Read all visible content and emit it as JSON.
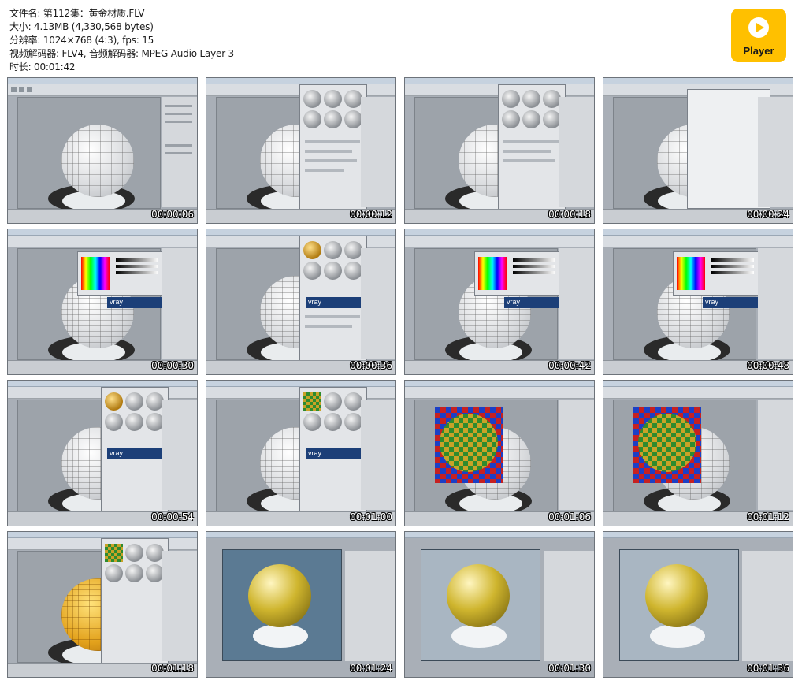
{
  "info": {
    "filename": "文件名: 第112集：黄金材质.FLV",
    "size": "大小: 4.13MB (4,330,568 bytes)",
    "resolution": "分辨率: 1024×768 (4:3), fps: 15",
    "codec": "视频解码器: FLV4, 音频解码器: MPEG Audio Layer 3",
    "duration": "时长: 00:01:42"
  },
  "player_logo": {
    "label": "Player",
    "color": "#ffc000"
  },
  "thumbnails": [
    {
      "time": "00:00:06"
    },
    {
      "time": "00:00:12"
    },
    {
      "time": "00:00:18"
    },
    {
      "time": "00:00:24"
    },
    {
      "time": "00:00:30"
    },
    {
      "time": "00:00:36"
    },
    {
      "time": "00:00:42"
    },
    {
      "time": "00:00:48"
    },
    {
      "time": "00:00:54"
    },
    {
      "time": "00:01:00"
    },
    {
      "time": "00:01:06"
    },
    {
      "time": "00:01:12"
    },
    {
      "time": "00:01:18"
    },
    {
      "time": "00:01:24"
    },
    {
      "time": "00:01:30"
    },
    {
      "time": "00:01:36"
    }
  ],
  "icons": {
    "play": "play-icon"
  },
  "vray_label": "vray"
}
